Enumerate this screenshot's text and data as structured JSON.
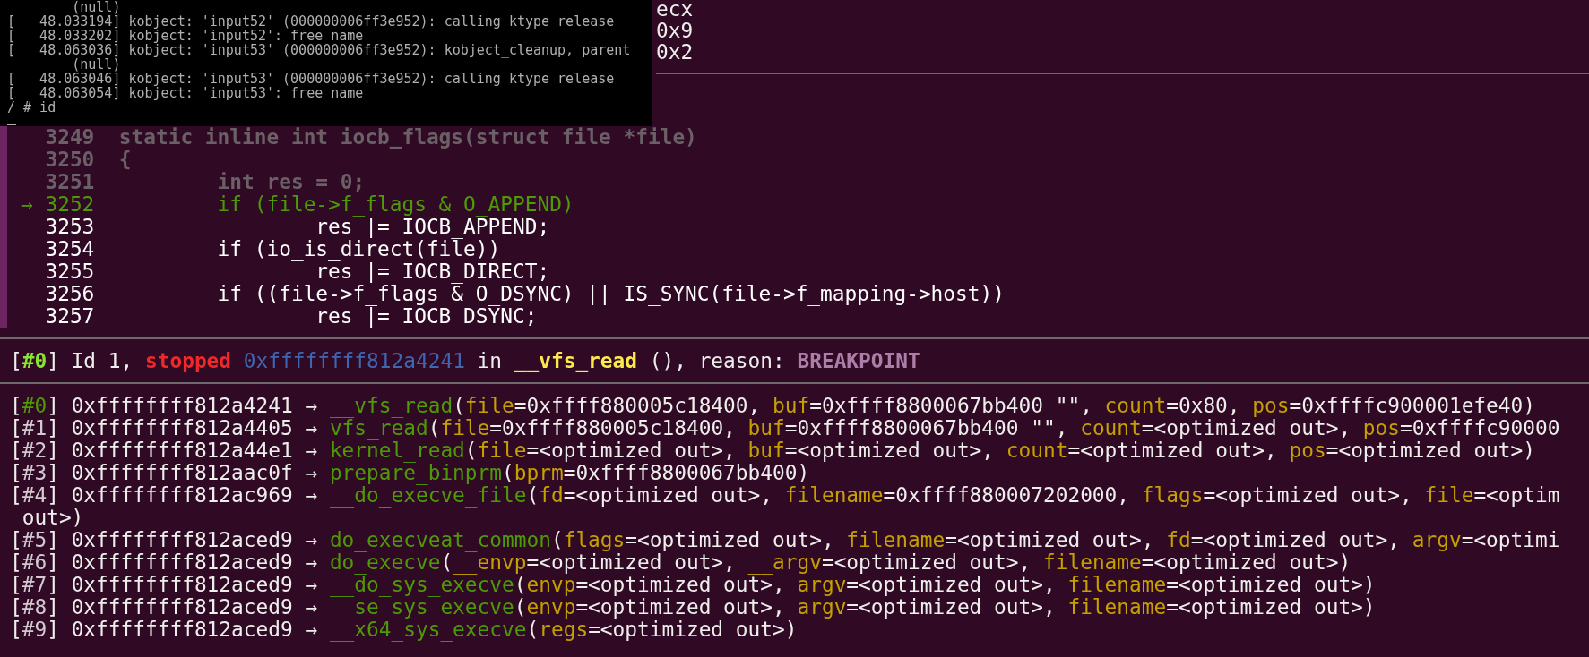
{
  "console": {
    "lines": [
      "        (null)",
      "[   48.033194] kobject: 'input52' (000000006ff3e952): calling ktype release",
      "[   48.033202] kobject: 'input52': free name",
      "[   48.063036] kobject: 'input53' (000000006ff3e952): kobject_cleanup, parent",
      "        (null)",
      "[   48.063046] kobject: 'input53' (000000006ff3e952): calling ktype release",
      "[   48.063054] kobject: 'input53': free name",
      "/ # id"
    ]
  },
  "registers_tail": [
    "ecx",
    "0x9",
    "0x2"
  ],
  "source": [
    {
      "number": "3249",
      "code": "static inline int iocb_flags(struct file *file)",
      "kind": "past"
    },
    {
      "number": "3250",
      "code": "{",
      "kind": "past"
    },
    {
      "number": "3251",
      "code": "        int res = 0;",
      "kind": "past"
    },
    {
      "number": "3252",
      "code": "        if (file->f_flags & O_APPEND)",
      "kind": "current",
      "marker": "→"
    },
    {
      "number": "3253",
      "code": "                res |= IOCB_APPEND;",
      "kind": "next"
    },
    {
      "number": "3254",
      "code": "        if (io_is_direct(file))",
      "kind": "next"
    },
    {
      "number": "3255",
      "code": "                res |= IOCB_DIRECT;",
      "kind": "next"
    },
    {
      "number": "3256",
      "code": "        if ((file->f_flags & O_DSYNC) || IS_SYNC(file->f_mapping->host))",
      "kind": "next"
    },
    {
      "number": "3257",
      "code": "                res |= IOCB_DSYNC;",
      "kind": "next"
    }
  ],
  "thread": [
    {
      "kind": "plain",
      "text": "["
    },
    {
      "kind": "index_active",
      "text": "#0"
    },
    {
      "kind": "plain",
      "text": "] Id 1, "
    },
    {
      "kind": "status",
      "text": "stopped"
    },
    {
      "kind": "address",
      "text": " 0xffffffff812a4241"
    },
    {
      "kind": "plain",
      "text": " in "
    },
    {
      "kind": "func_hl",
      "text": "__vfs_read"
    },
    {
      "kind": "plain",
      "text": " (), reason: "
    },
    {
      "kind": "reason",
      "text": "BREAKPOINT"
    }
  ],
  "backtrace": [
    [
      {
        "kind": "plain",
        "text": "["
      },
      {
        "kind": "index_current",
        "text": "#0"
      },
      {
        "kind": "plain",
        "text": "] 0xffffffff812a4241 → "
      },
      {
        "kind": "func",
        "text": "__vfs_read"
      },
      {
        "kind": "plain",
        "text": "("
      },
      {
        "kind": "arg",
        "text": "file"
      },
      {
        "kind": "plain",
        "text": "=0xffff880005c18400, "
      },
      {
        "kind": "arg",
        "text": "buf"
      },
      {
        "kind": "plain",
        "text": "=0xffff8800067bb400 \"\", "
      },
      {
        "kind": "arg",
        "text": "count"
      },
      {
        "kind": "plain",
        "text": "=0x80, "
      },
      {
        "kind": "arg",
        "text": "pos"
      },
      {
        "kind": "plain",
        "text": "=0xffffc900001efe40)"
      }
    ],
    [
      {
        "kind": "plain",
        "text": "["
      },
      {
        "kind": "index",
        "text": "#1"
      },
      {
        "kind": "plain",
        "text": "] 0xffffffff812a4405 → "
      },
      {
        "kind": "func",
        "text": "vfs_read"
      },
      {
        "kind": "plain",
        "text": "("
      },
      {
        "kind": "arg",
        "text": "file"
      },
      {
        "kind": "plain",
        "text": "=0xffff880005c18400, "
      },
      {
        "kind": "arg",
        "text": "buf"
      },
      {
        "kind": "plain",
        "text": "=0xffff8800067bb400 \"\", "
      },
      {
        "kind": "arg",
        "text": "count"
      },
      {
        "kind": "plain",
        "text": "=<optimized out>, "
      },
      {
        "kind": "arg",
        "text": "pos"
      },
      {
        "kind": "plain",
        "text": "=0xffffc90000"
      }
    ],
    [
      {
        "kind": "plain",
        "text": "["
      },
      {
        "kind": "index",
        "text": "#2"
      },
      {
        "kind": "plain",
        "text": "] 0xffffffff812a44e1 → "
      },
      {
        "kind": "func",
        "text": "kernel_read"
      },
      {
        "kind": "plain",
        "text": "("
      },
      {
        "kind": "arg",
        "text": "file"
      },
      {
        "kind": "plain",
        "text": "=<optimized out>, "
      },
      {
        "kind": "arg",
        "text": "buf"
      },
      {
        "kind": "plain",
        "text": "=<optimized out>, "
      },
      {
        "kind": "arg",
        "text": "count"
      },
      {
        "kind": "plain",
        "text": "=<optimized out>, "
      },
      {
        "kind": "arg",
        "text": "pos"
      },
      {
        "kind": "plain",
        "text": "=<optimized out>)"
      }
    ],
    [
      {
        "kind": "plain",
        "text": "["
      },
      {
        "kind": "index",
        "text": "#3"
      },
      {
        "kind": "plain",
        "text": "] 0xffffffff812aac0f → "
      },
      {
        "kind": "func",
        "text": "prepare_binprm"
      },
      {
        "kind": "plain",
        "text": "("
      },
      {
        "kind": "arg",
        "text": "bprm"
      },
      {
        "kind": "plain",
        "text": "=0xffff8800067bb400)"
      }
    ],
    [
      {
        "kind": "plain",
        "text": "["
      },
      {
        "kind": "index",
        "text": "#4"
      },
      {
        "kind": "plain",
        "text": "] 0xffffffff812ac969 → "
      },
      {
        "kind": "func",
        "text": "__do_execve_file"
      },
      {
        "kind": "plain",
        "text": "("
      },
      {
        "kind": "arg",
        "text": "fd"
      },
      {
        "kind": "plain",
        "text": "=<optimized out>, "
      },
      {
        "kind": "arg",
        "text": "filename"
      },
      {
        "kind": "plain",
        "text": "=0xffff880007202000, "
      },
      {
        "kind": "arg",
        "text": "flags"
      },
      {
        "kind": "plain",
        "text": "=<optimized out>, "
      },
      {
        "kind": "arg",
        "text": "file"
      },
      {
        "kind": "plain",
        "text": "=<optim"
      }
    ],
    [
      {
        "kind": "plain",
        "text": " out>)"
      }
    ],
    [
      {
        "kind": "plain",
        "text": "["
      },
      {
        "kind": "index",
        "text": "#5"
      },
      {
        "kind": "plain",
        "text": "] 0xffffffff812aced9 → "
      },
      {
        "kind": "func",
        "text": "do_execveat_common"
      },
      {
        "kind": "plain",
        "text": "("
      },
      {
        "kind": "arg",
        "text": "flags"
      },
      {
        "kind": "plain",
        "text": "=<optimized out>, "
      },
      {
        "kind": "arg",
        "text": "filename"
      },
      {
        "kind": "plain",
        "text": "=<optimized out>, "
      },
      {
        "kind": "arg",
        "text": "fd"
      },
      {
        "kind": "plain",
        "text": "=<optimized out>, "
      },
      {
        "kind": "arg",
        "text": "argv"
      },
      {
        "kind": "plain",
        "text": "=<optimi"
      }
    ],
    [
      {
        "kind": "plain",
        "text": "["
      },
      {
        "kind": "index",
        "text": "#6"
      },
      {
        "kind": "plain",
        "text": "] 0xffffffff812aced9 → "
      },
      {
        "kind": "func",
        "text": "do_execve"
      },
      {
        "kind": "plain",
        "text": "("
      },
      {
        "kind": "arg",
        "text": "__envp"
      },
      {
        "kind": "plain",
        "text": "=<optimized out>, "
      },
      {
        "kind": "arg",
        "text": "__argv"
      },
      {
        "kind": "plain",
        "text": "=<optimized out>, "
      },
      {
        "kind": "arg",
        "text": "filename"
      },
      {
        "kind": "plain",
        "text": "=<optimized out>)"
      }
    ],
    [
      {
        "kind": "plain",
        "text": "["
      },
      {
        "kind": "index",
        "text": "#7"
      },
      {
        "kind": "plain",
        "text": "] 0xffffffff812aced9 → "
      },
      {
        "kind": "func",
        "text": "__do_sys_execve"
      },
      {
        "kind": "plain",
        "text": "("
      },
      {
        "kind": "arg",
        "text": "envp"
      },
      {
        "kind": "plain",
        "text": "=<optimized out>, "
      },
      {
        "kind": "arg",
        "text": "argv"
      },
      {
        "kind": "plain",
        "text": "=<optimized out>, "
      },
      {
        "kind": "arg",
        "text": "filename"
      },
      {
        "kind": "plain",
        "text": "=<optimized out>)"
      }
    ],
    [
      {
        "kind": "plain",
        "text": "["
      },
      {
        "kind": "index",
        "text": "#8"
      },
      {
        "kind": "plain",
        "text": "] 0xffffffff812aced9 → "
      },
      {
        "kind": "func",
        "text": "__se_sys_execve"
      },
      {
        "kind": "plain",
        "text": "("
      },
      {
        "kind": "arg",
        "text": "envp"
      },
      {
        "kind": "plain",
        "text": "=<optimized out>, "
      },
      {
        "kind": "arg",
        "text": "argv"
      },
      {
        "kind": "plain",
        "text": "=<optimized out>, "
      },
      {
        "kind": "arg",
        "text": "filename"
      },
      {
        "kind": "plain",
        "text": "=<optimized out>)"
      }
    ],
    [
      {
        "kind": "plain",
        "text": "["
      },
      {
        "kind": "index",
        "text": "#9"
      },
      {
        "kind": "plain",
        "text": "] 0xffffffff812aced9 → "
      },
      {
        "kind": "func",
        "text": "__x64_sys_execve"
      },
      {
        "kind": "plain",
        "text": "("
      },
      {
        "kind": "arg",
        "text": "regs"
      },
      {
        "kind": "plain",
        "text": "=<optimized out>)"
      }
    ]
  ]
}
